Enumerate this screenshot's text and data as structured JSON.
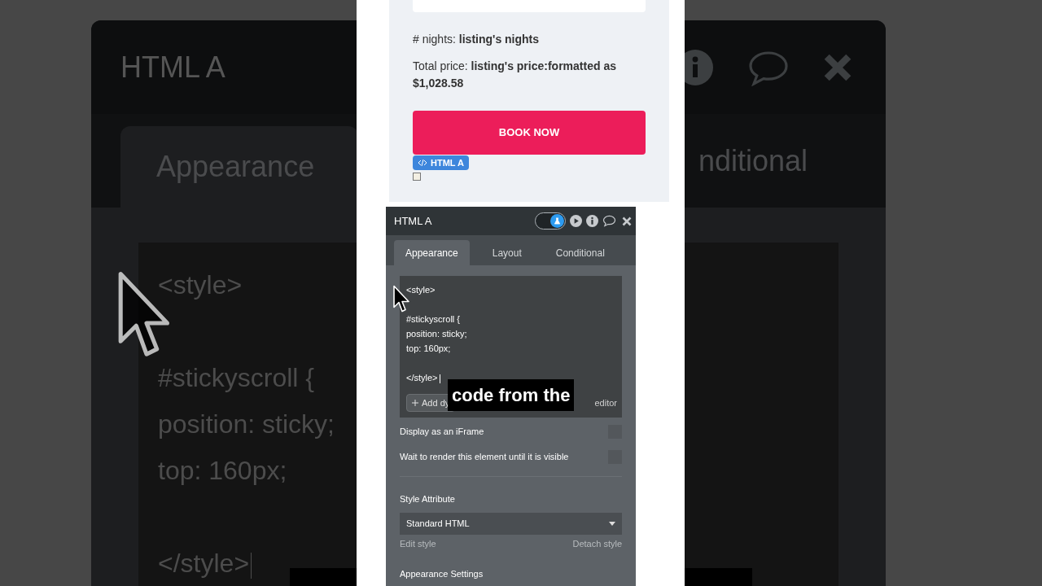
{
  "backdrop": {
    "title": "HTML A",
    "tab": "Appearance",
    "tab_cut": "nditional",
    "code_lines": [
      {
        "text": "<style>",
        "blank_before": false
      },
      {
        "text": "#stickyscroll {",
        "blank_before": true
      },
      {
        "text": "position: sticky;",
        "blank_before": false
      },
      {
        "text": "top: 160px;",
        "blank_before": false
      },
      {
        "text": "</style>",
        "blank_before": true
      }
    ]
  },
  "listing": {
    "nights": "# nights: **listing's nights**",
    "total": "Total price: **listing's price:formatted as $1,028.58**",
    "button": "BOOK NOW",
    "element_badge": "HTML A",
    "small_checkbox": {
      "checked": false
    }
  },
  "panel": {
    "title": "HTML A",
    "toggle_on": true,
    "tabs": [
      {
        "label": "Appearance",
        "selected": true
      },
      {
        "label": "Layout",
        "selected": false
      },
      {
        "label": "Conditional",
        "selected": false
      }
    ],
    "code_lines": [
      {
        "text": "<style>",
        "blank_before": false
      },
      {
        "text": "#stickyscroll {",
        "blank_before": true
      },
      {
        "text": "position: sticky;",
        "blank_before": false
      },
      {
        "text": "top: 160px;",
        "blank_before": false
      },
      {
        "text": "</style>",
        "blank_before": true
      }
    ],
    "add_button": "Add dy",
    "editor_link": "editor",
    "options": [
      {
        "label": "Display as an iFrame",
        "checked": false
      },
      {
        "label": "Wait to render this element until it is visible",
        "checked": false
      }
    ],
    "style_attribute_label": "Style Attribute",
    "style_select": "Standard HTML",
    "edit_style": "Edit style",
    "detach_style": "Detach style",
    "section": "Appearance Settings"
  },
  "caption": "code from the"
}
